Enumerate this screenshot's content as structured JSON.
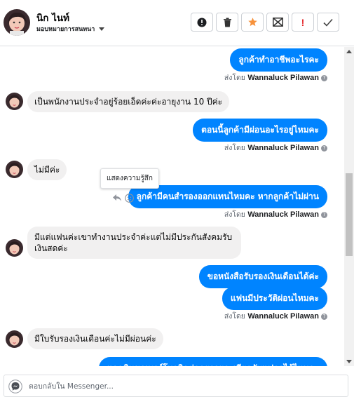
{
  "header": {
    "contact_name": "นิก ไนท์",
    "assign_label": "มอบหมายการสนทนา",
    "toolbar": [
      {
        "name": "report-button",
        "icon": "alert-circle-icon"
      },
      {
        "name": "delete-button",
        "icon": "trash-icon"
      },
      {
        "name": "star-button",
        "icon": "star-icon"
      },
      {
        "name": "mark-unread-button",
        "icon": "envelope-x-icon"
      },
      {
        "name": "spam-button",
        "icon": "exclamation-icon",
        "label": "!"
      },
      {
        "name": "done-button",
        "icon": "check-icon"
      }
    ]
  },
  "sent_by_prefix": "ส่งโดย",
  "sent_by_name": "Wannaluck Pilawan",
  "messages": [
    {
      "dir": "out",
      "text": "ลูกค้าทำอาชีพอะไรคะ"
    },
    {
      "dir": "in",
      "text": "เป็นพนักงานประจำอยู่ร้อยเอ็ดค่ะค่ะอายุงาน 10 ปีค่ะ"
    },
    {
      "dir": "out",
      "text": "ตอนนี้ลูกค้ามีผ่อนอะไรอยู่ไหมคะ"
    },
    {
      "dir": "in",
      "text": "ไม่มีค่ะ"
    },
    {
      "dir": "out",
      "text": "ลูกค้ามีคนสำรองออกแทนไหมคะ  หากลูกค้าไม่ผ่าน"
    },
    {
      "dir": "in",
      "text": "มีแต่แฟนค่ะเขาทำงานประจำค่ะแต่ไม่มีประกันสังคมรับ เงินสดค่ะ"
    },
    {
      "dir": "out",
      "text": "ขอหนังสือรับรองเงินเดือนได้ค่ะ"
    },
    {
      "dir": "out",
      "text": "แฟนมีประวัติผ่อนไหมคะ"
    },
    {
      "dir": "in",
      "text": "มีใบรับรองเงินเดือนค่ะไม่มีผ่อนค่ะ"
    },
    {
      "dir": "out",
      "text": "แอดมินขอเบอร์โทรติดต่อคุยรายละเอียดกับแฟลอได้ไหมคะ"
    }
  ],
  "tooltip": "แสดงความรู้สึก",
  "composer": {
    "placeholder": "ตอบกลับใน Messenger..."
  },
  "colors": {
    "bubble_out": "#0084ff",
    "bubble_in": "#f1f0f0",
    "star": "#f7923b",
    "spam": "#e4282c"
  }
}
